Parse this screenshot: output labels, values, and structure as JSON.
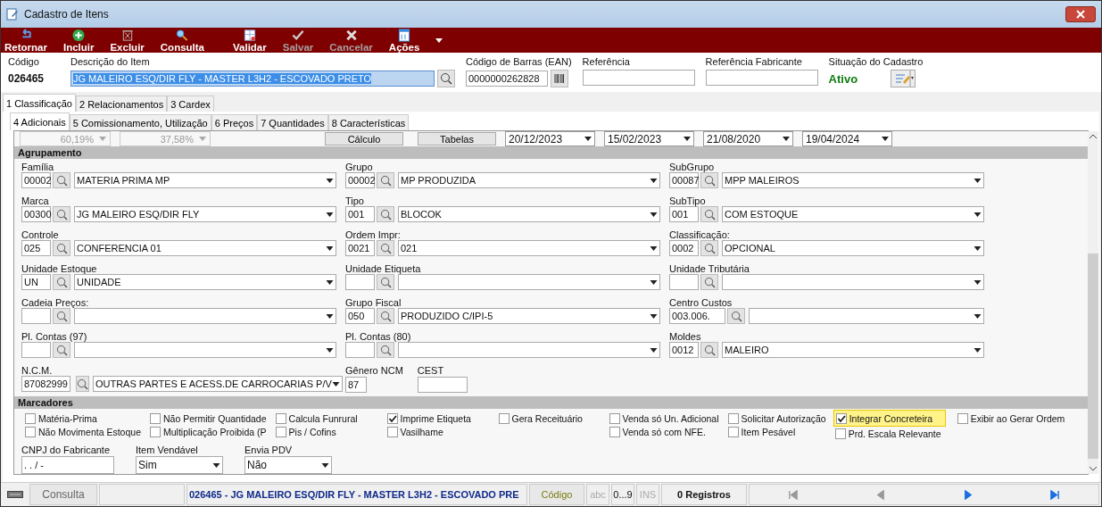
{
  "window": {
    "title": "Cadastro de Itens"
  },
  "toolbar": [
    {
      "label": "Retornar",
      "disabled": false
    },
    {
      "label": "Incluir",
      "disabled": false
    },
    {
      "label": "Excluir",
      "disabled": false
    },
    {
      "label": "Consulta",
      "disabled": false
    },
    {
      "label": "Validar",
      "disabled": false
    },
    {
      "label": "Salvar",
      "disabled": true
    },
    {
      "label": "Cancelar",
      "disabled": true
    },
    {
      "label": "Ações",
      "disabled": false
    }
  ],
  "header": {
    "codigo_label": "Código",
    "codigo": "026465",
    "descricao_label": "Descrição do Item",
    "descricao": "JG MALEIRO ESQ/DIR FLY - MASTER L3H2 - ESCOVADO PRETO",
    "ean_label": "Código de Barras (EAN)",
    "ean": "0000000262828",
    "referencia_label": "Referência",
    "ref_fabricante_label": "Referência Fabricante",
    "situacao_label": "Situação do Cadastro",
    "situacao": "Ativo"
  },
  "tabs": [
    {
      "label": "1 Classificação",
      "selected": true
    },
    {
      "label": "2 Relacionamentos",
      "selected": false
    },
    {
      "label": "3 Cardex",
      "selected": false
    }
  ],
  "subtabs": [
    {
      "label": "4 Adicionais",
      "selected": true
    },
    {
      "label": "5 Comissionamento, Utilização",
      "selected": false
    },
    {
      "label": "6 Preços",
      "selected": false
    },
    {
      "label": "7 Quantidades",
      "selected": false
    },
    {
      "label": "8 Características",
      "selected": false
    }
  ],
  "top_row": {
    "rates": [
      "60,19%",
      "37,58%"
    ],
    "buttons": [
      "Cálculo",
      "Tabelas"
    ],
    "dates": [
      "20/12/2023",
      "15/02/2023",
      "21/08/2020",
      "19/04/2024"
    ]
  },
  "agrupamento": {
    "title": "Agrupamento",
    "fields": [
      {
        "label": "Família",
        "code": "00002",
        "description": "MATERIA PRIMA MP",
        "wide": false
      },
      {
        "label": "Grupo",
        "code": "00002",
        "description": "MP PRODUZIDA",
        "wide": false
      },
      {
        "label": "SubGrupo",
        "code": "00087",
        "description": "MPP MALEIROS",
        "wide": false
      },
      {
        "label": "Marca",
        "code": "00300",
        "description": "JG MALEIRO ESQ/DIR FLY",
        "wide": false
      },
      {
        "label": "Tipo",
        "code": "001",
        "description": "BLOCOK",
        "wide": false
      },
      {
        "label": "SubTipo",
        "code": "001",
        "description": "COM ESTOQUE",
        "wide": false
      },
      {
        "label": "Controle",
        "code": "025",
        "description": "CONFERENCIA 01",
        "wide": false
      },
      {
        "label": "Ordem Impr:",
        "code": "0021",
        "description": "021",
        "wide": false
      },
      {
        "label": "Classificação:",
        "code": "0002",
        "description": "OPCIONAL",
        "wide": false
      },
      {
        "label": "Unidade Estoque",
        "code": "UN",
        "description": "UNIDADE",
        "wide": false
      },
      {
        "label": "Unidade Etiqueta",
        "wide": false
      },
      {
        "label": "Unidade Tributária",
        "wide": false
      },
      {
        "label": "Cadeia Preços:",
        "wide": false
      },
      {
        "label": "Grupo Fiscal",
        "code": "050",
        "description": "PRODUZIDO C/IPI-5",
        "wide": false
      },
      {
        "label": "Centro Custos",
        "code": "003.006.",
        "wide": true
      },
      {
        "label": "Pl. Contas (97)",
        "wide": false
      },
      {
        "label": "Pl. Contas (80)",
        "wide": false
      },
      {
        "label": "Moldes",
        "code": "0012",
        "description": "MALEIRO",
        "wide": false
      }
    ],
    "ncm": {
      "label": "N.C.M.",
      "code": "87082999",
      "description": "OUTRAS PARTES E ACESS.DE CARROCARIAS P/V"
    },
    "genero": {
      "label": "Gênero NCM",
      "value": "87"
    },
    "cest": {
      "label": "CEST"
    }
  },
  "marcadores": {
    "title": "Marcadores",
    "columns": [
      [
        {
          "label": "Matéria-Prima",
          "checked": false,
          "highlighted": false
        },
        {
          "label": "Não Movimenta Estoque",
          "checked": false,
          "highlighted": false
        }
      ],
      [
        {
          "label": "Não Permitir Quantidade",
          "checked": false,
          "highlighted": false
        },
        {
          "label": "Multiplicação Proibida (P",
          "checked": false,
          "highlighted": false
        }
      ],
      [
        {
          "label": "Calcula Funrural",
          "checked": false,
          "highlighted": false
        },
        {
          "label": "Pis / Cofins",
          "checked": false,
          "highlighted": false
        }
      ],
      [
        {
          "label": "Imprime Etiqueta",
          "checked": true,
          "highlighted": false
        },
        {
          "label": "Vasilhame",
          "checked": false,
          "highlighted": false
        }
      ],
      [
        {
          "label": "Gera Receituário",
          "checked": false,
          "highlighted": false
        }
      ],
      [
        {
          "label": "Venda só Un. Adicional",
          "checked": false,
          "highlighted": false
        },
        {
          "label": "Venda só com NFE.",
          "checked": false,
          "highlighted": false
        }
      ],
      [
        {
          "label": "Solicitar Autorização",
          "checked": false,
          "highlighted": false
        },
        {
          "label": "Item Pesável",
          "checked": false,
          "highlighted": false
        }
      ],
      [
        {
          "label": "Integrar Concreteira",
          "checked": true,
          "highlighted": true
        },
        {
          "label": "Prd. Escala Relevante",
          "checked": false,
          "highlighted": false
        }
      ],
      [
        {
          "label": "Exibir ao Gerar Ordem",
          "checked": false,
          "highlighted": false
        }
      ]
    ]
  },
  "bottom": {
    "cnpj_label": "CNPJ do Fabricante",
    "cnpj": " .  .  /   -",
    "vendavel_label": "Item Vendável",
    "vendavel": "Sim",
    "pdv_label": "Envia PDV",
    "pdv": "Não"
  },
  "status_bar": {
    "mode": "Consulta",
    "record": "026465 - JG MALEIRO ESQ/DIR FLY - MASTER L3H2 - ESCOVADO PRE",
    "key": "Código",
    "abc": "abc",
    "digits": "0...9",
    "ins": "INS",
    "count": "0 Registros",
    "nav": [
      {
        "disabled": true
      },
      {
        "disabled": true
      },
      {
        "disabled": false
      },
      {
        "disabled": false
      }
    ]
  }
}
